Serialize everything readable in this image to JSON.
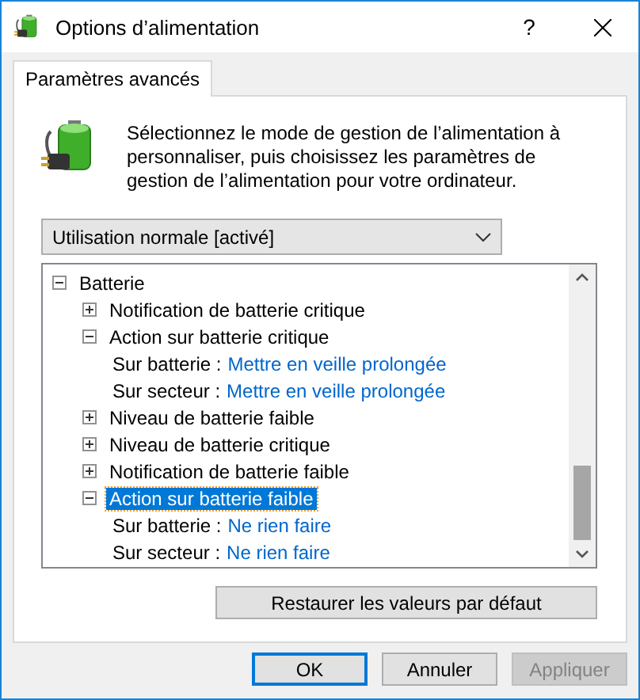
{
  "window": {
    "title": "Options d’alimentation",
    "help": "?"
  },
  "tabs": [
    {
      "label": "Paramètres avancés",
      "selected": true
    }
  ],
  "intro": "Sélectionnez le mode de gestion de l’alimentation à personnaliser, puis choisissez les paramètres de gestion de l’alimentation pour votre ordinateur.",
  "plan_select": {
    "value": "Utilisation normale [activé]"
  },
  "tree": [
    {
      "kind": "group",
      "label": "Batterie",
      "expanded": true,
      "selected": false,
      "children": [
        {
          "kind": "group",
          "label": "Notification de batterie critique",
          "expanded": false,
          "selected": false
        },
        {
          "kind": "group",
          "label": "Action sur batterie critique",
          "expanded": true,
          "selected": false,
          "children": [
            {
              "kind": "setting",
              "label": "Sur batterie :",
              "value": "Mettre en veille prolongée"
            },
            {
              "kind": "setting",
              "label": "Sur secteur :",
              "value": "Mettre en veille prolongée"
            }
          ]
        },
        {
          "kind": "group",
          "label": "Niveau de batterie faible",
          "expanded": false,
          "selected": false
        },
        {
          "kind": "group",
          "label": "Niveau de batterie critique",
          "expanded": false,
          "selected": false
        },
        {
          "kind": "group",
          "label": "Notification de batterie faible",
          "expanded": false,
          "selected": false
        },
        {
          "kind": "group",
          "label": "Action sur batterie faible",
          "expanded": true,
          "selected": true,
          "children": [
            {
              "kind": "setting",
              "label": "Sur batterie :",
              "value": "Ne rien faire"
            },
            {
              "kind": "setting",
              "label": "Sur secteur :",
              "value": "Ne rien faire"
            }
          ]
        }
      ]
    }
  ],
  "restore_button": "Restaurer les valeurs par défaut",
  "buttons": [
    {
      "label": "OK",
      "kind": "default",
      "disabled": false
    },
    {
      "label": "Annuler",
      "kind": "normal",
      "disabled": false
    },
    {
      "label": "Appliquer",
      "kind": "normal",
      "disabled": true
    }
  ]
}
